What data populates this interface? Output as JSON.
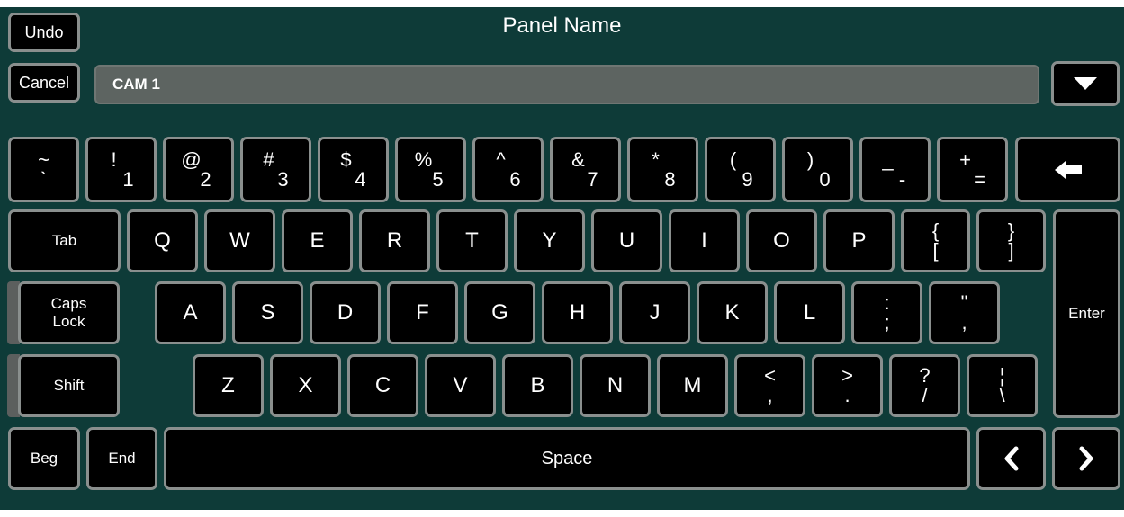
{
  "title": "Panel Name",
  "buttons": {
    "undo": "Undo",
    "cancel": "Cancel",
    "dropdown_icon": "triangle-down-icon"
  },
  "input": {
    "value": "CAM 1"
  },
  "row1": [
    {
      "up": "~",
      "lo": "`"
    },
    {
      "up": "!",
      "lo": "1"
    },
    {
      "up": "@",
      "lo": "2"
    },
    {
      "up": "#",
      "lo": "3"
    },
    {
      "up": "$",
      "lo": "4"
    },
    {
      "up": "%",
      "lo": "5"
    },
    {
      "up": "^",
      "lo": "6"
    },
    {
      "up": "&",
      "lo": "7"
    },
    {
      "up": "*",
      "lo": "8"
    },
    {
      "up": "(",
      "lo": "9"
    },
    {
      "up": ")",
      "lo": "0"
    },
    {
      "up": "_",
      "lo": "-"
    },
    {
      "up": "+",
      "lo": "="
    }
  ],
  "row2_letters": [
    "Q",
    "W",
    "E",
    "R",
    "T",
    "Y",
    "U",
    "I",
    "O",
    "P"
  ],
  "row2_brackets": [
    {
      "up": "{",
      "lo": "["
    },
    {
      "up": "}",
      "lo": "]"
    }
  ],
  "row3_letters": [
    "A",
    "S",
    "D",
    "F",
    "G",
    "H",
    "J",
    "K",
    "L"
  ],
  "row3_symbols": [
    {
      "up": ":",
      "lo": ";"
    },
    {
      "up": "\"",
      "lo": ","
    }
  ],
  "row4_letters": [
    "Z",
    "X",
    "C",
    "V",
    "B",
    "N",
    "M"
  ],
  "row4_symbols": [
    {
      "up": "<",
      "lo": ","
    },
    {
      "up": ">",
      "lo": "."
    },
    {
      "up": "?",
      "lo": "/"
    },
    {
      "up": "¦",
      "lo": "\\"
    }
  ],
  "labels": {
    "tab": "Tab",
    "caps_line1": "Caps",
    "caps_line2": "Lock",
    "shift": "Shift",
    "enter": "Enter",
    "beg": "Beg",
    "end": "End",
    "space": "Space"
  },
  "icons": {
    "backspace": "backspace-arrow-icon",
    "left": "chevron-left-icon",
    "right": "chevron-right-icon"
  }
}
